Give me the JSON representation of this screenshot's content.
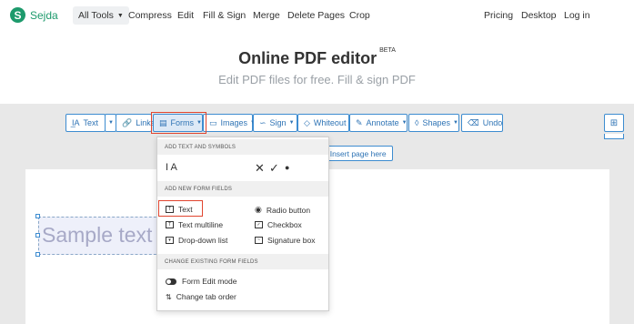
{
  "nav": {
    "logo_letter": "S",
    "logo_text": "Sejda",
    "all_tools": "All Tools",
    "links": [
      "Compress",
      "Edit",
      "Fill & Sign",
      "Merge",
      "Delete Pages",
      "Crop"
    ],
    "right_links": [
      "Pricing",
      "Desktop",
      "Log in"
    ]
  },
  "hero": {
    "title": "Online PDF editor",
    "beta": "BETA",
    "subtitle": "Edit PDF files for free. Fill & sign PDF"
  },
  "toolbar": {
    "text": "Text",
    "links": "Links",
    "forms": "Forms",
    "images": "Images",
    "sign": "Sign",
    "whiteout": "Whiteout",
    "annotate": "Annotate",
    "shapes": "Shapes",
    "undo": "Undo"
  },
  "insert_page": "Insert page here",
  "sample_text": "Sample text",
  "forms_menu": {
    "section1": "ADD TEXT AND SYMBOLS",
    "symbols": {
      "text_tool": "I A",
      "cross": "✕",
      "check": "✓",
      "dot": "●"
    },
    "section2": "ADD NEW FORM FIELDS",
    "fields_left": [
      "Text",
      "Text multiline",
      "Drop-down list"
    ],
    "fields_right": [
      "Radio button",
      "Checkbox",
      "Signature box"
    ],
    "section3": "CHANGE EXISTING FORM FIELDS",
    "existing": [
      "Form Edit mode",
      "Change tab order"
    ]
  },
  "colors": {
    "brand": "#1d9a6c",
    "accent": "#2f74b5",
    "highlight": "#e0452f"
  }
}
